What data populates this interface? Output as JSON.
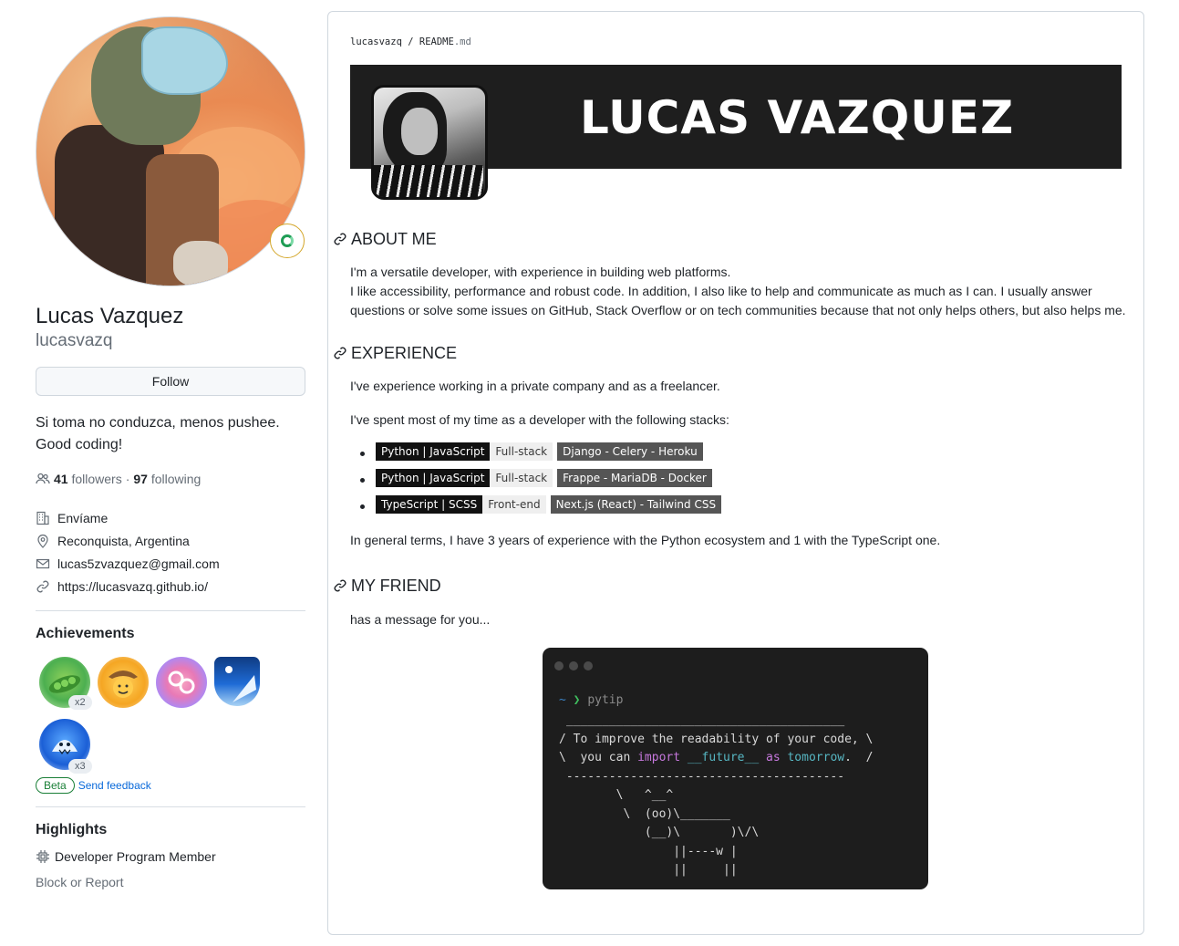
{
  "profile": {
    "full_name": "Lucas Vazquez",
    "username": "lucasvazq",
    "follow_label": "Follow",
    "bio_line1": "Si toma no conduzca, menos pushee.",
    "bio_line2": "Good coding!",
    "followers_count": "41",
    "followers_label": "followers",
    "separator": "·",
    "following_count": "97",
    "following_label": "following",
    "company": "Envíame",
    "location": "Reconquista, Argentina",
    "email": "lucas5zvazquez@gmail.com",
    "website": "https://lucasvazq.github.io/"
  },
  "achievements": {
    "title": "Achievements",
    "badges": [
      {
        "name": "pair-extraordinaire",
        "count": "x2"
      },
      {
        "name": "quickdraw"
      },
      {
        "name": "yolo"
      },
      {
        "name": "starstruck"
      },
      {
        "name": "pull-shark",
        "count": "x3"
      }
    ],
    "beta_label": "Beta",
    "feedback_label": "Send feedback"
  },
  "highlights": {
    "title": "Highlights",
    "item": "Developer Program Member",
    "block_report": "Block or Report"
  },
  "readme": {
    "path_user": "lucasvazq",
    "path_sep": " / ",
    "path_file": "README",
    "path_ext": ".md",
    "banner_name": "LUCAS VAZQUEZ",
    "about_title": "ABOUT ME",
    "about_p1": "I'm a versatile developer, with experience in building web platforms.",
    "about_p2": "I like accessibility, performance and robust code. In addition, I also like to help and communicate as much as I can. I usually answer",
    "about_p3": "questions or solve some issues on GitHub, Stack Overflow or on tech communities because that not only helps others, but also helps me.",
    "experience_title": "EXPERIENCE",
    "exp_p1": "I've experience working in a private company and as a freelancer.",
    "exp_p2": "I've spent most of my time as a developer with the following stacks:",
    "stacks": [
      {
        "lang": "Python | JavaScript",
        "scope": "Full-stack",
        "tools": "Django - Celery - Heroku"
      },
      {
        "lang": "Python | JavaScript",
        "scope": "Full-stack",
        "tools": "Frappe - MariaDB - Docker"
      },
      {
        "lang": "TypeScript | SCSS",
        "scope": "Front-end",
        "tools": "Next.js (React) - Tailwind CSS"
      }
    ],
    "exp_p3": "In general terms, I have 3 years of experience with the Python ecosystem and 1 with the TypeScript one.",
    "friend_title": "MY FRIEND",
    "friend_p": "has a message for you...",
    "terminal": {
      "tilde": "~",
      "arrow": "❯",
      "command": "pytip",
      "top_rule": "_______________________________________",
      "line1": "/ To improve the readability of your code, \\",
      "line2_a": "\\  you can ",
      "line2_import": "import",
      "line2_future": "__future__",
      "line2_as": "as",
      "line2_tomorrow": "tomorrow",
      "line2_end": ".  /",
      "bottom_rule": " ---------------------------------------",
      "cow": "        \\   ^__^\n         \\  (oo)\\_______\n            (__)\\       )\\/\\\n                ||----w |\n                ||     ||"
    }
  },
  "colors": {
    "link": "#0969da",
    "muted": "#656d76",
    "beta_green": "#1a7f37",
    "terminal_bg": "#1d1d1d",
    "keyword": "#c678dd",
    "identifier": "#56b6c2"
  }
}
